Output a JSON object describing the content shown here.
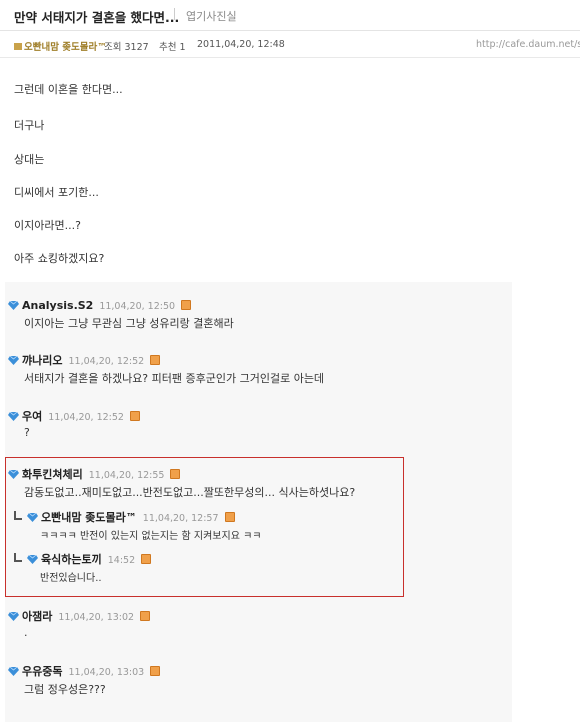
{
  "article": {
    "title": "만약 서태지가 결혼을 했다면...",
    "category": "엽기사진실",
    "meta": {
      "author": "오빤내맘 좆도몰라™",
      "views": "조회 3127",
      "recommend": "추천 1",
      "date": "2011,04,20, 12:48",
      "url": "http://cafe.daum.net/ss"
    },
    "body_lines": [
      "그런데 이혼을 한다면...",
      "더구나",
      "상대는",
      "디씨에서 포기한...",
      "이지아라면...?",
      "아주 쇼킹하겠지요?"
    ]
  },
  "comments": [
    {
      "name": "Analysis.S2",
      "time": "11,04,20, 12:50",
      "text": "이지아는 그냥 무관심 그냥 성유리랑 결혼해라"
    },
    {
      "name": "꺄나리오",
      "time": "11,04,20, 12:52",
      "text": "서태지가 결혼을 하겠나요? 피터팬 증후군인가 그거인걸로 아는데"
    },
    {
      "name": "우여",
      "time": "11,04,20, 12:52",
      "text": "?"
    },
    {
      "name": "화투킨쳐체리",
      "time": "11,04,20, 12:55",
      "text": "감동도없고..재미도없고...반전도없고...짤또한무성의... 식사는하셧나요?"
    },
    {
      "name": "아잼라",
      "time": "11,04,20, 13:02",
      "text": "."
    },
    {
      "name": "우유중독",
      "time": "11,04,20, 13:03",
      "text": "그럼 정우성은???"
    }
  ],
  "replies": [
    {
      "name": "오빤내맘 좆도몰라™",
      "time": "11,04,20, 12:57",
      "text": "ㅋㅋㅋㅋ 반전이 있는지 없는지는 함 지켜보지요 ㅋㅋ"
    },
    {
      "name": "육식하는토끼",
      "time": "14:52",
      "text": "반전있습니다.."
    }
  ],
  "colors": {
    "highlight_border": "#c8302c",
    "gem": "#3b8fd9",
    "delete_icon": "#f0a04a"
  }
}
